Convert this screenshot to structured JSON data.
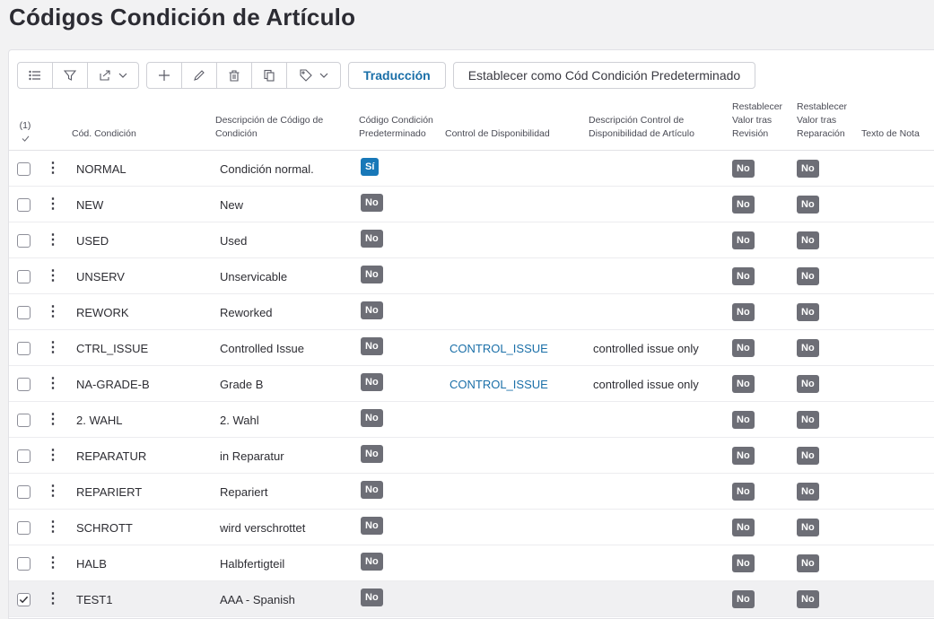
{
  "page": {
    "title": "Códigos Condición de Artículo"
  },
  "toolbar": {
    "translate_label": "Traducción",
    "set_default_label": "Establecer como Cód Condición Predeterminado"
  },
  "table": {
    "selected_count": "(1)",
    "headers": {
      "code": "Cód. Condición",
      "description": "Descripción de Código de Condición",
      "default": "Código Condición Predeterminado",
      "availability": "Control de Disponibilidad",
      "availability_desc": "Descripción Control de Disponibilidad de Artículo",
      "reset_revision": "Restablecer Valor tras Revisión",
      "reset_repair": "Restablecer Valor tras Reparación",
      "note": "Texto de Nota"
    },
    "rows": [
      {
        "code": "NORMAL",
        "description": "Condición normal.",
        "default": "Sí",
        "availability": "",
        "availability_desc": "",
        "reset_revision": "No",
        "reset_repair": "No",
        "checked": false
      },
      {
        "code": "NEW",
        "description": "New",
        "default": "No",
        "availability": "",
        "availability_desc": "",
        "reset_revision": "No",
        "reset_repair": "No",
        "checked": false
      },
      {
        "code": "USED",
        "description": "Used",
        "default": "No",
        "availability": "",
        "availability_desc": "",
        "reset_revision": "No",
        "reset_repair": "No",
        "checked": false
      },
      {
        "code": "UNSERV",
        "description": "Unservicable",
        "default": "No",
        "availability": "",
        "availability_desc": "",
        "reset_revision": "No",
        "reset_repair": "No",
        "checked": false
      },
      {
        "code": "REWORK",
        "description": "Reworked",
        "default": "No",
        "availability": "",
        "availability_desc": "",
        "reset_revision": "No",
        "reset_repair": "No",
        "checked": false
      },
      {
        "code": "CTRL_ISSUE",
        "description": "Controlled Issue",
        "default": "No",
        "availability": "CONTROL_ISSUE",
        "availability_desc": "controlled issue only",
        "reset_revision": "No",
        "reset_repair": "No",
        "checked": false
      },
      {
        "code": "NA-GRADE-B",
        "description": "Grade B",
        "default": "No",
        "availability": "CONTROL_ISSUE",
        "availability_desc": "controlled issue only",
        "reset_revision": "No",
        "reset_repair": "No",
        "checked": false
      },
      {
        "code": "2. WAHL",
        "description": "2. Wahl",
        "default": "No",
        "availability": "",
        "availability_desc": "",
        "reset_revision": "No",
        "reset_repair": "No",
        "checked": false
      },
      {
        "code": "REPARATUR",
        "description": "in Reparatur",
        "default": "No",
        "availability": "",
        "availability_desc": "",
        "reset_revision": "No",
        "reset_repair": "No",
        "checked": false
      },
      {
        "code": "REPARIERT",
        "description": "Repariert",
        "default": "No",
        "availability": "",
        "availability_desc": "",
        "reset_revision": "No",
        "reset_repair": "No",
        "checked": false
      },
      {
        "code": "SCHROTT",
        "description": "wird verschrottet",
        "default": "No",
        "availability": "",
        "availability_desc": "",
        "reset_revision": "No",
        "reset_repair": "No",
        "checked": false
      },
      {
        "code": "HALB",
        "description": "Halbfertigteil",
        "default": "No",
        "availability": "",
        "availability_desc": "",
        "reset_revision": "No",
        "reset_repair": "No",
        "checked": false
      },
      {
        "code": "TEST1",
        "description": "AAA - Spanish",
        "default": "No",
        "availability": "",
        "availability_desc": "",
        "reset_revision": "No",
        "reset_repair": "No",
        "checked": true
      }
    ]
  },
  "colors": {
    "accent": "#1a6fa8",
    "badge_yes": "#1878b8",
    "badge_no": "#6d6e76"
  },
  "icons": [
    "list-icon",
    "filter-icon",
    "export-icon",
    "plus-icon",
    "pencil-icon",
    "trash-icon",
    "copy-icon",
    "tag-icon",
    "checkmark-icon",
    "kebab-icon"
  ]
}
